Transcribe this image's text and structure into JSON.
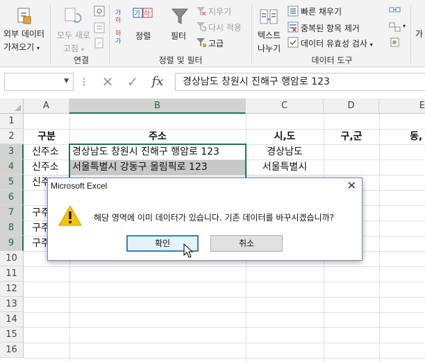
{
  "ribbon": {
    "get_external": [
      "외부 데이터",
      "가져오기"
    ],
    "refresh_all": [
      "모두 새로",
      "고침"
    ],
    "sort_filter": {
      "sort": "정렬",
      "filter": "필터",
      "clear": "지우기",
      "reapply": "다시 적용",
      "advanced": "고급"
    },
    "data_tools": {
      "text_to_columns": [
        "텍스트",
        "나누기"
      ],
      "flash_fill": "빠른 채우기",
      "remove_duplicates": "중복된 항목 제거",
      "data_validation": "데이터 유효성 검사"
    },
    "groups": {
      "connections": "연결",
      "sort_filter": "정렬 및 필터",
      "data_tools": "데이터 도구"
    }
  },
  "formula_bar": {
    "formula": "경상남도 창원시 진해구 행암로 123",
    "fx_label": "fx"
  },
  "grid": {
    "columns": [
      "A",
      "B",
      "C",
      "D",
      "E"
    ],
    "rows": [
      "1",
      "2",
      "3",
      "4",
      "5",
      "6",
      "7",
      "8",
      "9",
      "10",
      "11",
      "12",
      "13",
      "14",
      "15",
      "16"
    ],
    "headers": {
      "a": "구분",
      "b": "주소",
      "c": "시,도",
      "d": "구,군",
      "e": "동,"
    },
    "cells": {
      "a3": "신주소",
      "b3": "경상남도 창원시 진해구 행암로 123",
      "c3": "경상남도",
      "a4": "신주소",
      "b4": "서울특별시 강동구 올림픽로 123",
      "c4": "서울특별시",
      "a5": "신주",
      "a7": "구주",
      "a8": "구주",
      "a9": "구주"
    }
  },
  "dialog": {
    "title": "Microsoft Excel",
    "message": "해당 영역에 이미 데이터가 있습니다. 기존 데이터를 바꾸시겠습니까?",
    "ok": "확인",
    "cancel": "취소"
  },
  "colors": {
    "excel_green": "#217346",
    "warning_yellow": "#f6c500"
  }
}
